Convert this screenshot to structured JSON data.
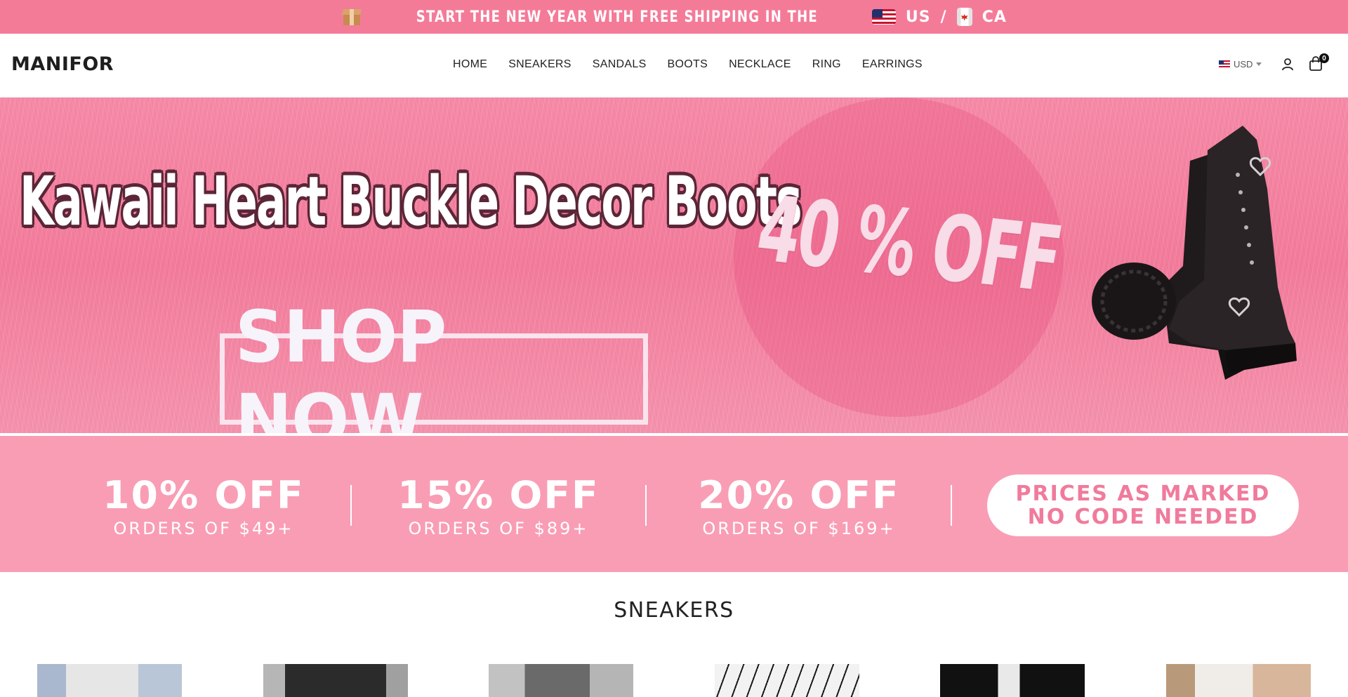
{
  "announcement": {
    "text": "START THE NEW YEAR WITH FREE SHIPPING IN THE",
    "country_1": "US",
    "separator": "/",
    "country_2": "CA"
  },
  "header": {
    "logo": "MANIFOR",
    "nav": [
      "HOME",
      "SNEAKERS",
      "SANDALS",
      "BOOTS",
      "NECKLACE",
      "RING",
      "EARRINGS"
    ],
    "currency": "USD",
    "cart_count": "0"
  },
  "hero": {
    "headline": "Kawaii Heart Buckle Decor Boots",
    "discount": "40 % OFF",
    "cta": "SHOP NOW"
  },
  "promo": {
    "tiers": [
      {
        "discount": "10% OFF",
        "condition": "ORDERS OF $49+"
      },
      {
        "discount": "15% OFF",
        "condition": "ORDERS OF $89+"
      },
      {
        "discount": "20% OFF",
        "condition": "ORDERS OF $169+"
      }
    ],
    "note_line1": "PRICES AS MARKED",
    "note_line2": "NO CODE NEEDED"
  },
  "section": {
    "title": "SNEAKERS"
  },
  "colors": {
    "announcement_bg": "#f47b98",
    "promo_bg": "#f99db5",
    "hero_bg": "#f27b9b"
  }
}
